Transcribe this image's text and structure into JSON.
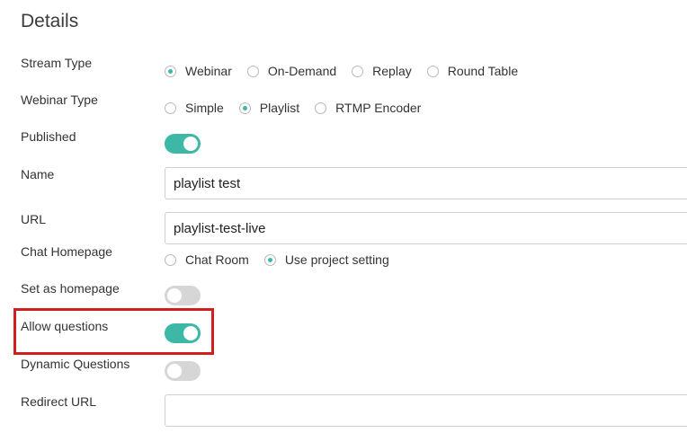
{
  "section": {
    "title": "Details"
  },
  "fields": {
    "stream_type": {
      "label": "Stream Type",
      "options": [
        {
          "label": "Webinar",
          "checked": true
        },
        {
          "label": "On-Demand",
          "checked": false
        },
        {
          "label": "Replay",
          "checked": false
        },
        {
          "label": "Round Table",
          "checked": false
        }
      ]
    },
    "webinar_type": {
      "label": "Webinar Type",
      "options": [
        {
          "label": "Simple",
          "checked": false
        },
        {
          "label": "Playlist",
          "checked": true
        },
        {
          "label": "RTMP Encoder",
          "checked": false
        }
      ]
    },
    "published": {
      "label": "Published",
      "on": true
    },
    "name": {
      "label": "Name",
      "value": "playlist test"
    },
    "url": {
      "label": "URL",
      "value": "playlist-test-live"
    },
    "chat_homepage": {
      "label": "Chat Homepage",
      "options": [
        {
          "label": "Chat Room",
          "checked": false
        },
        {
          "label": "Use project setting",
          "checked": true
        }
      ]
    },
    "set_as_homepage": {
      "label": "Set as homepage",
      "on": false
    },
    "allow_questions": {
      "label": "Allow questions",
      "on": true
    },
    "dynamic_questions": {
      "label": "Dynamic Questions",
      "on": false
    },
    "redirect_url": {
      "label": "Redirect URL",
      "value": ""
    }
  },
  "colors": {
    "accent": "#3db8a7",
    "toggle_off": "#d6d6d6",
    "highlight": "#d11f1f"
  }
}
